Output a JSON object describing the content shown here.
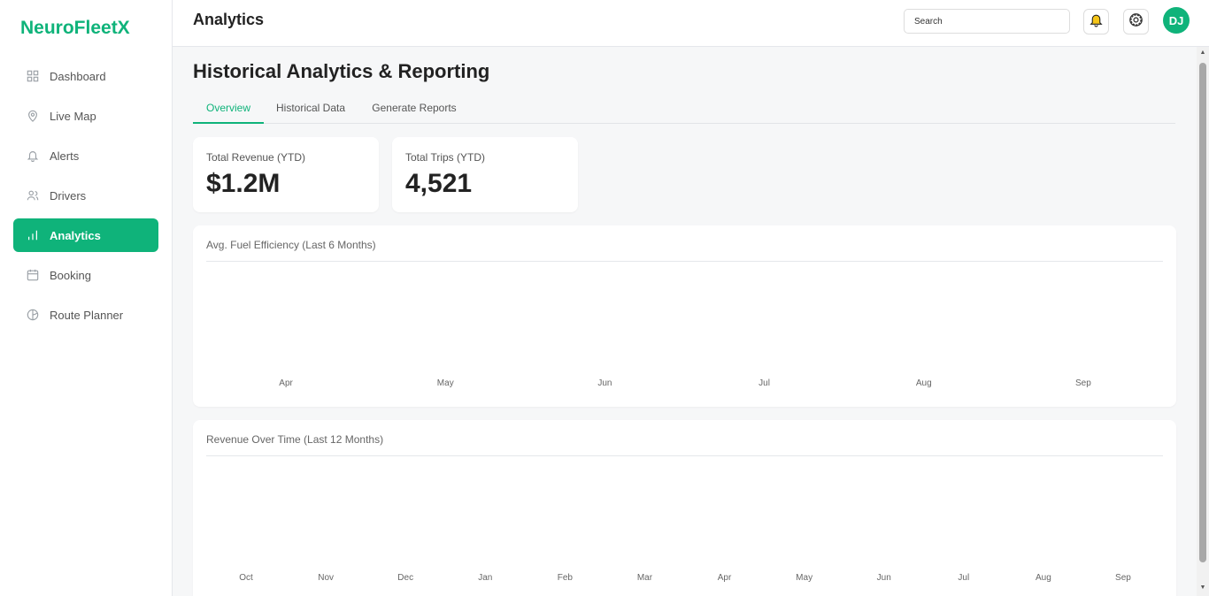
{
  "brand": "NeuroFleetX",
  "sidebar": {
    "items": [
      {
        "label": "Dashboard",
        "icon": "grid-icon",
        "active": false
      },
      {
        "label": "Live Map",
        "icon": "map-pin-icon",
        "active": false
      },
      {
        "label": "Alerts",
        "icon": "bell-icon",
        "active": false
      },
      {
        "label": "Drivers",
        "icon": "users-icon",
        "active": false
      },
      {
        "label": "Analytics",
        "icon": "bar-chart-icon",
        "active": true
      },
      {
        "label": "Booking",
        "icon": "calendar-icon",
        "active": false
      },
      {
        "label": "Route Planner",
        "icon": "compass-icon",
        "active": false
      }
    ]
  },
  "header": {
    "title": "Analytics",
    "search_placeholder": "Search",
    "avatar_initials": "DJ"
  },
  "main": {
    "page_title": "Historical Analytics & Reporting",
    "tabs": [
      {
        "label": "Overview",
        "active": true
      },
      {
        "label": "Historical Data",
        "active": false
      },
      {
        "label": "Generate Reports",
        "active": false
      }
    ],
    "kpis": [
      {
        "label": "Total Revenue (YTD)",
        "value": "$1.2M"
      },
      {
        "label": "Total Trips (YTD)",
        "value": "4,521"
      }
    ]
  },
  "colors": {
    "accent": "#0fb37a",
    "bell": "#f5c518"
  },
  "chart_data": [
    {
      "type": "bar",
      "title": "Avg. Fuel Efficiency (Last 6 Months)",
      "categories": [
        "Apr",
        "May",
        "Jun",
        "Jul",
        "Aug",
        "Sep"
      ],
      "values": []
    },
    {
      "type": "line",
      "title": "Revenue Over Time (Last 12 Months)",
      "categories": [
        "Oct",
        "Nov",
        "Dec",
        "Jan",
        "Feb",
        "Mar",
        "Apr",
        "May",
        "Jun",
        "Jul",
        "Aug",
        "Sep"
      ],
      "values": []
    }
  ]
}
